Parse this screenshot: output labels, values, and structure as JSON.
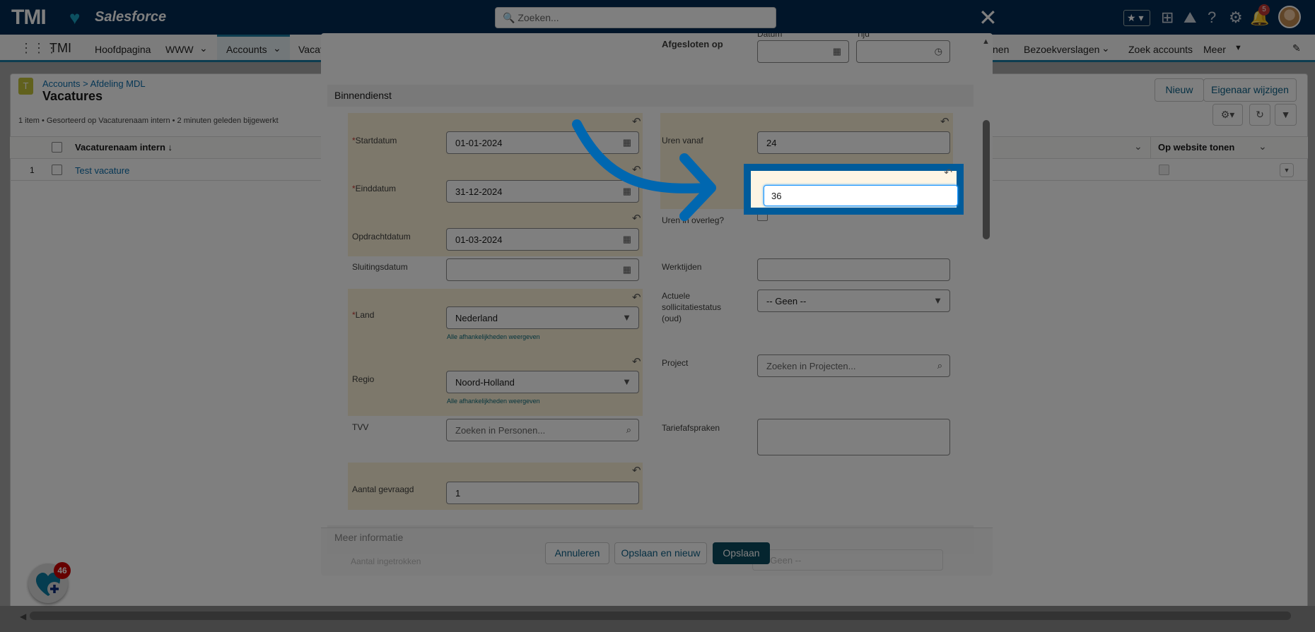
{
  "header": {
    "logo_text": "TMI",
    "logo_brand": "Salesforce",
    "search_placeholder": "Zoeken...",
    "close_label": "✕",
    "notification_count": "5"
  },
  "nav": {
    "app_name": "TMI",
    "items": [
      "Hoofdpagina",
      "WWW",
      "Accounts",
      "Vacat",
      "nen",
      "Bezoekverslagen",
      "Zoek accounts",
      "Meer"
    ]
  },
  "list": {
    "breadcrumb": "Accounts > Afdeling MDL",
    "title": "Vacatures",
    "status": "1 item • Gesorteerd op Vacaturenaam intern • 2 minuten geleden bijgewerkt",
    "new_button": "Nieuw",
    "owner_button": "Eigenaar wijzigen",
    "col_name": "Vacaturenaam intern ↓",
    "col_website": "Op website tonen",
    "row_num": "1",
    "row_name": "Test vacature"
  },
  "modal": {
    "closed_on_label": "Afgesloten op",
    "date_label": "Datum",
    "time_label": "Tijd",
    "section": "Binnendienst",
    "left": {
      "startdatum_label": "Startdatum",
      "startdatum": "01-01-2024",
      "einddatum_label": "Einddatum",
      "einddatum": "31-12-2024",
      "opdrachtdatum_label": "Opdrachtdatum",
      "opdrachtdatum": "01-03-2024",
      "sluitingsdatum_label": "Sluitingsdatum",
      "land_label": "Land",
      "land": "Nederland",
      "deps_link": "Alle afhankelijkheden weergeven",
      "regio_label": "Regio",
      "regio": "Noord-Holland",
      "tvv_label": "TVV",
      "tvv_placeholder": "Zoeken in Personen...",
      "aantal_label": "Aantal gevraagd",
      "aantal": "1"
    },
    "right": {
      "uren_vanaf_label": "Uren vanaf",
      "uren_vanaf": "24",
      "uren_tot": "36",
      "overleg_label": "Uren in overleg?",
      "werktijden_label": "Werktijden",
      "status_label": "Actuele sollicitatiestatus (oud)",
      "status_value": "-- Geen --",
      "project_label": "Project",
      "project_placeholder": "Zoeken in Projecten...",
      "tarief_label": "Tariefafspraken"
    },
    "next_section": "Meer informatie",
    "next_field": "Aantal ingetrokken",
    "next_select": "-- Geen --",
    "buttons": {
      "cancel": "Annuleren",
      "save_new": "Opslaan en nieuw",
      "save": "Opslaan"
    }
  },
  "fab_badge": "46",
  "colors": {
    "highlight": "#005b9a",
    "primary_button": "#0b4a5e",
    "arrow": "#0067b0"
  }
}
